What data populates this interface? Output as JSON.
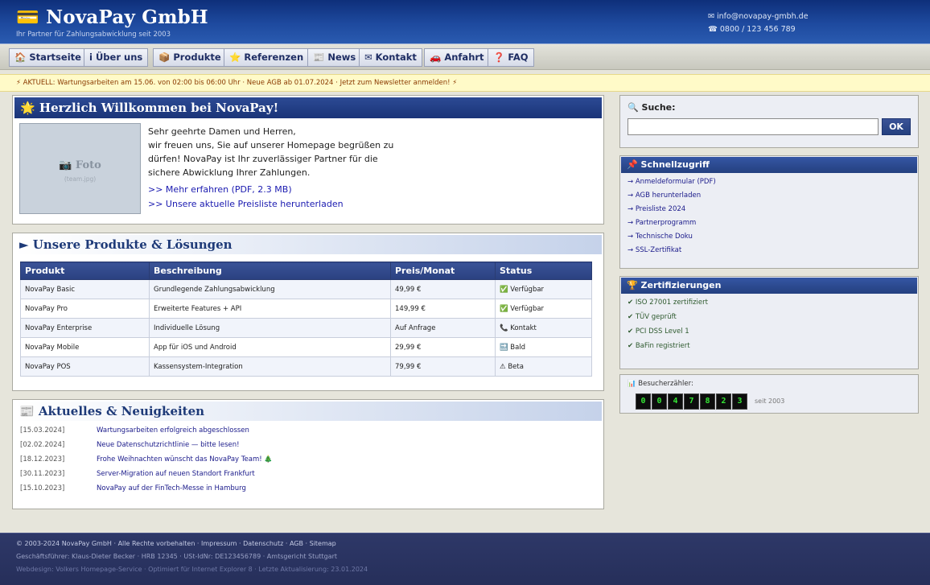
{
  "header": {
    "brand": "NovaPay GmbH",
    "brand_icon": "💳",
    "tagline": "Ihr Partner für Zahlungsabwicklung seit 2003",
    "email": "info@novapay-gmbh.de",
    "phone": "0800 / 123 456 789",
    "email_icon": "✉",
    "phone_icon": "☎"
  },
  "nav": [
    {
      "icon": "🏠",
      "label": "Startseite"
    },
    {
      "icon": "i",
      "label": "Über uns"
    },
    {
      "icon": "📦",
      "label": "Produkte"
    },
    {
      "icon": "⭐",
      "label": "Referenzen"
    },
    {
      "icon": "📰",
      "label": "News"
    },
    {
      "icon": "✉",
      "label": "Kontakt"
    },
    {
      "icon": "🚗",
      "label": "Anfahrt"
    },
    {
      "icon": "❓",
      "label": "FAQ"
    }
  ],
  "ticker": "⚡ AKTUELL: Wartungsarbeiten am 15.06. von 02:00 bis 06:00 Uhr · Neue AGB ab 01.07.2024 · Jetzt zum Newsletter anmelden! ⚡",
  "welcome": {
    "title": "Herzlich Willkommen bei NovaPay!",
    "title_icon": "🌟",
    "photo_label": "Foto",
    "photo_icon": "📷",
    "photo_file": "team.jpg",
    "greeting": "Sehr geehrte Damen und Herren,",
    "body": "wir freuen uns, Sie auf unserer Homepage begrüßen zu dürfen! NovaPay ist Ihr zuverlässiger Partner für die sichere Abwicklung Ihrer Zahlungen.",
    "link1": ">> Mehr erfahren (PDF, 2.3 MB)",
    "link2": ">> Unsere aktuelle Preisliste herunterladen"
  },
  "products": {
    "title": "► Unsere Produkte & Lösungen",
    "columns": [
      "Produkt",
      "Beschreibung",
      "Preis/Monat",
      "Status"
    ],
    "rows": [
      [
        "NovaPay Basic",
        "Grundlegende Zahlungsabwicklung",
        "49,99 €",
        "✅ Verfügbar"
      ],
      [
        "NovaPay Pro",
        "Erweiterte Features + API",
        "149,99 €",
        "✅ Verfügbar"
      ],
      [
        "NovaPay Enterprise",
        "Individuelle Lösung",
        "Auf Anfrage",
        "📞 Kontakt"
      ],
      [
        "NovaPay Mobile",
        "App für iOS und Android",
        "29,99 €",
        "🔜 Bald"
      ],
      [
        "NovaPay POS",
        "Kassensystem-Integration",
        "79,99 €",
        "⚠ Beta"
      ]
    ]
  },
  "news": {
    "title": "Aktuelles & Neuigkeiten",
    "title_icon": "📰",
    "items": [
      {
        "date": "[15.03.2024]",
        "title": "Wartungsarbeiten erfolgreich abgeschlossen"
      },
      {
        "date": "[02.02.2024]",
        "title": "Neue Datenschutzrichtlinie — bitte lesen!"
      },
      {
        "date": "[18.12.2023]",
        "title": "Frohe Weihnachten wünscht das NovaPay Team! 🎄"
      },
      {
        "date": "[30.11.2023]",
        "title": "Server-Migration auf neuen Standort Frankfurt"
      },
      {
        "date": "[15.10.2023]",
        "title": "NovaPay auf der FinTech-Messe in Hamburg"
      }
    ]
  },
  "search": {
    "label": "Suche:",
    "icon": "🔍",
    "value": "",
    "button": "OK"
  },
  "quick": {
    "title": "Schnellzugriff",
    "icon": "📌",
    "links": [
      "→ Anmeldeformular (PDF)",
      "→ AGB herunterladen",
      "→ Preisliste 2024",
      "→ Partnerprogramm",
      "→ Technische Doku",
      "→ SSL-Zertifikat"
    ]
  },
  "certs": {
    "title": "Zertifizierungen",
    "icon": "🏆",
    "items": [
      "✔ ISO 27001 zertifiziert",
      "✔ TÜV geprüft",
      "✔ PCI DSS Level 1",
      "✔ BaFin registriert"
    ]
  },
  "counter": {
    "label": "Besucherzähler:",
    "icon": "📊",
    "digits": [
      "0",
      "0",
      "4",
      "7",
      "8",
      "2",
      "3"
    ],
    "since": "seit 2003"
  },
  "footer": {
    "line1": "© 2003-2024 NovaPay GmbH · Alle Rechte vorbehalten · Impressum · Datenschutz · AGB · Sitemap",
    "line2": "Geschäftsführer: Klaus-Dieter Becker · HRB 12345 · USt-IdNr: DE123456789 · Amtsgericht Stuttgart",
    "line3": "Webdesign: Volkers Homepage-Service · Optimiert für Internet Explorer 8 · Letzte Aktualisierung: 23.01.2024"
  },
  "colors": {
    "header_blue": "#1e4a9f",
    "nav_text": "#1e2d63",
    "ticker_bg": "#fffac8",
    "footer_bg": "#2a3360",
    "counter_digit": "#35e635"
  }
}
